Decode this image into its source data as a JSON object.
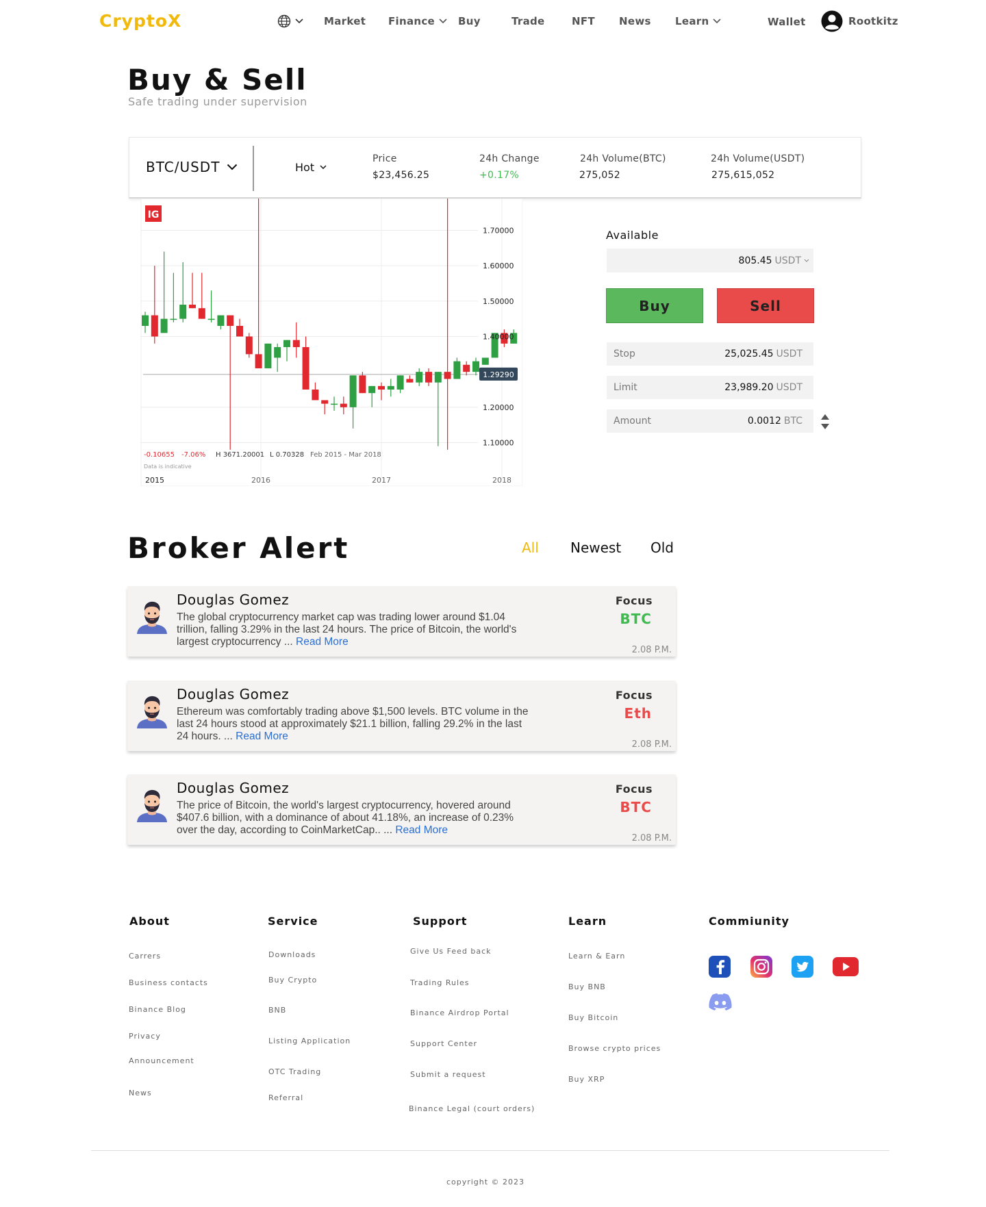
{
  "brand": {
    "logo": "CryptoX",
    "accent": "#f0b90b"
  },
  "nav": {
    "items": [
      {
        "label": "Market"
      },
      {
        "label": "Finance",
        "dropdown": true
      },
      {
        "label": "Buy"
      },
      {
        "label": "Trade"
      },
      {
        "label": "NFT"
      },
      {
        "label": "News"
      },
      {
        "label": "Learn",
        "dropdown": true
      }
    ],
    "language_icon": "globe-icon",
    "wallet": "Wallet",
    "user": "Rootkitz",
    "user_icon": "user-avatar-icon"
  },
  "page": {
    "title": "Buy & Sell",
    "subtitle": "Safe trading under supervision"
  },
  "ticker": {
    "pair": "BTC/USDT",
    "filter": "Hot",
    "stats": [
      {
        "label": "Price",
        "value": "$23,456.25"
      },
      {
        "label": "24h Change",
        "value": "+0.17%"
      },
      {
        "label": "24h Volume(BTC)",
        "value": "275,052"
      },
      {
        "label": "24h Volume(USDT)",
        "value": "275,615,052"
      }
    ]
  },
  "chart_data": {
    "type": "candlestick",
    "logo": "IG",
    "x_ticks": [
      "2015",
      "2016",
      "2017",
      "2018"
    ],
    "y_ticks": [
      "1.70000",
      "1.60000",
      "1.50000",
      "1.40000",
      "1.20000",
      "1.10000"
    ],
    "ylim": [
      1.07,
      1.79
    ],
    "current_price_label": "1.29290",
    "current_price": 1.2929,
    "info": {
      "change": "-0.10655",
      "change_pct": "-7.06%",
      "high": "H 3671.20001",
      "low": "L 0.70328",
      "range": "Feb 2015 - Mar 2018",
      "note": "Data is indicative"
    },
    "colors": {
      "up": "#2ea043",
      "down": "#e0282e"
    },
    "candles": [
      {
        "o": 1.43,
        "h": 1.47,
        "l": 1.41,
        "c": 1.46
      },
      {
        "o": 1.46,
        "h": 1.6,
        "l": 1.38,
        "c": 1.4
      },
      {
        "o": 1.41,
        "h": 1.64,
        "l": 1.41,
        "c": 1.45
      },
      {
        "o": 1.45,
        "h": 1.58,
        "l": 1.44,
        "c": 1.45
      },
      {
        "o": 1.45,
        "h": 1.61,
        "l": 1.44,
        "c": 1.49
      },
      {
        "o": 1.49,
        "h": 1.58,
        "l": 1.48,
        "c": 1.48
      },
      {
        "o": 1.48,
        "h": 1.58,
        "l": 1.47,
        "c": 1.45
      },
      {
        "o": 1.45,
        "h": 1.53,
        "l": 1.44,
        "c": 1.45
      },
      {
        "o": 1.43,
        "h": 1.46,
        "l": 1.42,
        "c": 1.46
      },
      {
        "o": 1.46,
        "h": 1.46,
        "l": 1.08,
        "c": 1.43
      },
      {
        "o": 1.43,
        "h": 1.45,
        "l": 1.4,
        "c": 1.4
      },
      {
        "o": 1.4,
        "h": 1.41,
        "l": 1.34,
        "c": 1.35
      },
      {
        "o": 1.35,
        "h": 1.79,
        "l": 1.33,
        "c": 1.31
      },
      {
        "o": 1.31,
        "h": 1.38,
        "l": 1.31,
        "c": 1.38
      },
      {
        "o": 1.34,
        "h": 1.38,
        "l": 1.3,
        "c": 1.37
      },
      {
        "o": 1.37,
        "h": 1.39,
        "l": 1.33,
        "c": 1.39
      },
      {
        "o": 1.39,
        "h": 1.44,
        "l": 1.34,
        "c": 1.37
      },
      {
        "o": 1.37,
        "h": 1.4,
        "l": 1.28,
        "c": 1.25
      },
      {
        "o": 1.25,
        "h": 1.27,
        "l": 1.27,
        "c": 1.22
      },
      {
        "o": 1.22,
        "h": 1.21,
        "l": 1.18,
        "c": 1.21
      },
      {
        "o": 1.21,
        "h": 1.23,
        "l": 1.19,
        "c": 1.21
      },
      {
        "o": 1.21,
        "h": 1.23,
        "l": 1.18,
        "c": 1.2
      },
      {
        "o": 1.2,
        "h": 1.29,
        "l": 1.14,
        "c": 1.29
      },
      {
        "o": 1.29,
        "h": 1.3,
        "l": 1.24,
        "c": 1.24
      },
      {
        "o": 1.24,
        "h": 1.24,
        "l": 1.2,
        "c": 1.26
      },
      {
        "o": 1.26,
        "h": 1.27,
        "l": 1.22,
        "c": 1.25
      },
      {
        "o": 1.25,
        "h": 1.28,
        "l": 1.23,
        "c": 1.26
      },
      {
        "o": 1.25,
        "h": 1.28,
        "l": 1.24,
        "c": 1.29
      },
      {
        "o": 1.28,
        "h": 1.29,
        "l": 1.27,
        "c": 1.27
      },
      {
        "o": 1.27,
        "h": 1.31,
        "l": 1.26,
        "c": 1.3
      },
      {
        "o": 1.3,
        "h": 1.31,
        "l": 1.26,
        "c": 1.27
      },
      {
        "o": 1.27,
        "h": 1.3,
        "l": 1.09,
        "c": 1.3
      },
      {
        "o": 1.3,
        "h": 1.79,
        "l": 1.08,
        "c": 1.28
      },
      {
        "o": 1.28,
        "h": 1.34,
        "l": 1.28,
        "c": 1.33
      },
      {
        "o": 1.32,
        "h": 1.33,
        "l": 1.29,
        "c": 1.3
      },
      {
        "o": 1.3,
        "h": 1.34,
        "l": 1.29,
        "c": 1.33
      },
      {
        "o": 1.32,
        "h": 1.34,
        "l": 1.32,
        "c": 1.34
      },
      {
        "o": 1.34,
        "h": 1.41,
        "l": 1.34,
        "c": 1.41
      },
      {
        "o": 1.41,
        "h": 1.42,
        "l": 1.37,
        "c": 1.38
      },
      {
        "o": 1.38,
        "h": 1.42,
        "l": 1.38,
        "c": 1.41
      }
    ]
  },
  "trade": {
    "available_label": "Available",
    "available_value": "805.45",
    "available_unit": "USDT",
    "buy_label": "Buy",
    "sell_label": "Sell",
    "buy_color": "#5cb85c",
    "sell_color": "#e94a4a",
    "fields": [
      {
        "label": "Stop",
        "value": "25,025.45",
        "unit": "USDT"
      },
      {
        "label": "Limit",
        "value": "23,989.20",
        "unit": "USDT"
      },
      {
        "label": "Amount",
        "value": "0.0012",
        "unit": "BTC"
      }
    ]
  },
  "alerts": {
    "title": "Broker Alert",
    "filters": [
      "All",
      "Newest",
      "Old"
    ],
    "active_filter": "All",
    "items": [
      {
        "name": "Douglas Gomez",
        "text": "The global cryptocurrency market cap was trading lower around $1.04 trillion, falling 3.29% in the last 24 hours. The price of Bitcoin, the world's largest cryptocurrency ... ",
        "read_more": "Read More",
        "focus_label": "Focus",
        "coin": "BTC",
        "coin_color": "#3fb950",
        "time": "2.08 P.M."
      },
      {
        "name": "Douglas Gomez",
        "text": "Ethereum was comfortably trading above $1,500 levels. BTC volume in the last 24 hours stood at approximately $21.1 billion, falling 29.2% in the last 24 hours. ... ",
        "read_more": "Read More",
        "focus_label": "Focus",
        "coin": "Eth",
        "coin_color": "#e94a4a",
        "time": "2.08 P.M."
      },
      {
        "name": "Douglas Gomez",
        "text": "The price of Bitcoin, the world's largest cryptocurrency, hovered around $407.6 billion, with a dominance of about 41.18%, an increase of 0.23% over the day, according to CoinMarketCap.. ... ",
        "read_more": "Read More",
        "focus_label": "Focus",
        "coin": "BTC",
        "coin_color": "#e94a4a",
        "time": "2.08 P.M."
      }
    ]
  },
  "footer": {
    "columns": [
      {
        "title": "About",
        "links": [
          "Carrers",
          "Business contacts",
          "Binance Blog",
          "Privacy",
          "Announcement",
          "News"
        ]
      },
      {
        "title": "Service",
        "links": [
          "Downloads",
          "Buy Crypto",
          "BNB",
          "Listing Application",
          "OTC Trading",
          "Referral"
        ]
      },
      {
        "title": "Support",
        "links": [
          "Give Us Feed back",
          "Trading Rules",
          "Binance Airdrop Portal",
          "Support Center",
          "Submit a request",
          "Binance Legal (court orders)"
        ]
      },
      {
        "title": "Learn",
        "links": [
          "Learn & Earn",
          "Buy BNB",
          "Buy Bitcoin",
          "Browse crypto prices",
          "Buy XRP"
        ]
      }
    ],
    "community_title": "Commiunity",
    "community_icons": [
      "facebook-icon",
      "instagram-icon",
      "twitter-icon",
      "youtube-icon",
      "discord-icon"
    ],
    "copyright": "copyright © 2023"
  }
}
